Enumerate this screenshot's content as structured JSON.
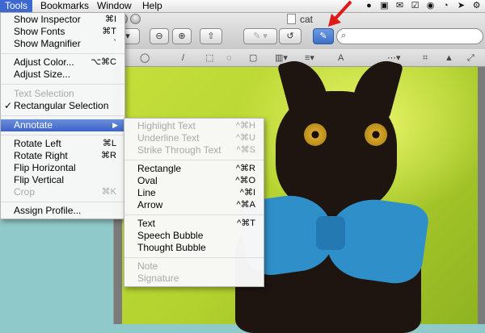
{
  "menubar": {
    "items": [
      "Tools",
      "Bookmarks",
      "Window",
      "Help"
    ]
  },
  "window": {
    "title": "cat"
  },
  "tools_menu": {
    "items": [
      {
        "label": "Show Inspector",
        "shortcut": "⌘I"
      },
      {
        "label": "Show Fonts",
        "shortcut": "⌘T"
      },
      {
        "label": "Show Magnifier",
        "shortcut": "`"
      },
      {
        "label": "Adjust Color...",
        "shortcut": "⌥⌘C"
      },
      {
        "label": "Adjust Size..."
      },
      {
        "label": "Text Selection"
      },
      {
        "label": "Rectangular Selection",
        "checked": "✓"
      },
      {
        "label": "Annotate",
        "submenu": "▶"
      },
      {
        "label": "Rotate Left",
        "shortcut": "⌘L"
      },
      {
        "label": "Rotate Right",
        "shortcut": "⌘R"
      },
      {
        "label": "Flip Horizontal"
      },
      {
        "label": "Flip Vertical"
      },
      {
        "label": "Crop",
        "shortcut": "⌘K"
      },
      {
        "label": "Assign Profile..."
      }
    ]
  },
  "annotate_submenu": {
    "items": [
      {
        "label": "Highlight Text",
        "shortcut": "^⌘H"
      },
      {
        "label": "Underline Text",
        "shortcut": "^⌘U"
      },
      {
        "label": "Strike Through Text",
        "shortcut": "^⌘S"
      },
      {
        "label": "Rectangle",
        "shortcut": "^⌘R"
      },
      {
        "label": "Oval",
        "shortcut": "^⌘O"
      },
      {
        "label": "Line",
        "shortcut": "^⌘I"
      },
      {
        "label": "Arrow",
        "shortcut": "^⌘A"
      },
      {
        "label": "Text",
        "shortcut": "^⌘T"
      },
      {
        "label": "Speech Bubble"
      },
      {
        "label": "Thought Bubble"
      },
      {
        "label": "Note"
      },
      {
        "label": "Signature"
      }
    ]
  },
  "colors": {
    "menu_highlight": "#3b63c9",
    "annotation_arrow": "#e01818",
    "bowtie": "#2f8fc8"
  }
}
